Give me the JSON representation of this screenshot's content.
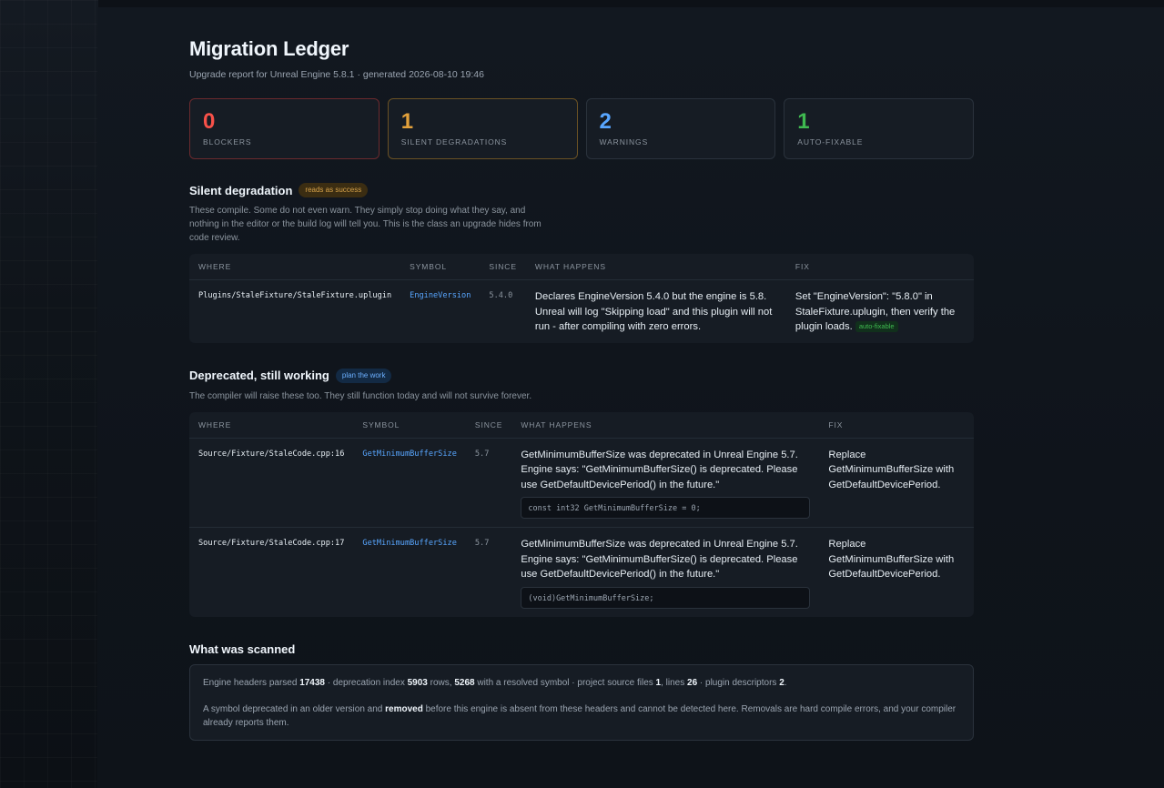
{
  "header": {
    "title": "Migration Ledger",
    "subtitle": "Upgrade report for Unreal Engine 5.8.1 · generated 2026-08-10 19:46"
  },
  "summary": [
    {
      "value": "0",
      "label": "BLOCKERS",
      "color": "#f85149"
    },
    {
      "value": "1",
      "label": "SILENT DEGRADATIONS",
      "color": "#e3a13b"
    },
    {
      "value": "2",
      "label": "WARNINGS",
      "color": "#58a6ff"
    },
    {
      "value": "1",
      "label": "AUTO-FIXABLE",
      "color": "#3fb950"
    }
  ],
  "silent": {
    "title": "Silent degradation",
    "badge": "reads as success",
    "description": "These compile. Some do not even warn. They simply stop doing what they say, and nothing in the editor or the build log will tell you. This is the class an upgrade hides from code review.",
    "columns": [
      "WHERE",
      "SYMBOL",
      "SINCE",
      "WHAT HAPPENS",
      "FIX"
    ],
    "rows": [
      {
        "where": "Plugins/StaleFixture/StaleFixture.uplugin",
        "symbol": "EngineVersion",
        "since": "5.4.0",
        "what": "Declares EngineVersion 5.4.0 but the engine is 5.8. Unreal will log \"Skipping load\" and this plugin will not run - after compiling with zero errors.",
        "fix": "Set \"EngineVersion\": \"5.8.0\" in StaleFixture.uplugin, then verify the plugin loads.",
        "tag": "auto-fixable"
      }
    ]
  },
  "deprecated": {
    "title": "Deprecated, still working",
    "badge": "plan the work",
    "description": "The compiler will raise these too. They still function today and will not survive forever.",
    "columns": [
      "WHERE",
      "SYMBOL",
      "SINCE",
      "WHAT HAPPENS",
      "FIX"
    ],
    "rows": [
      {
        "where": "Source/Fixture/StaleCode.cpp:16",
        "symbol": "GetMinimumBufferSize",
        "since": "5.7",
        "what": "GetMinimumBufferSize was deprecated in Unreal Engine 5.7. Engine says: \"GetMinimumBufferSize() is deprecated. Please use GetDefaultDevicePeriod() in the future.\"",
        "code": "const int32 GetMinimumBufferSize = 0;",
        "fix": "Replace GetMinimumBufferSize with GetDefaultDevicePeriod."
      },
      {
        "where": "Source/Fixture/StaleCode.cpp:17",
        "symbol": "GetMinimumBufferSize",
        "since": "5.7",
        "what": "GetMinimumBufferSize was deprecated in Unreal Engine 5.7. Engine says: \"GetMinimumBufferSize() is deprecated. Please use GetDefaultDevicePeriod() in the future.\"",
        "code": "(void)GetMinimumBufferSize;",
        "fix": "Replace GetMinimumBufferSize with GetDefaultDevicePeriod."
      }
    ]
  },
  "scanned": {
    "title": "What was scanned",
    "line1": {
      "p1": "Engine headers parsed ",
      "headers": "17438",
      "p2": " · deprecation index ",
      "index_rows": "5903",
      "p3": " rows, ",
      "resolved": "5268",
      "p4": " with a resolved symbol · project source files ",
      "files": "1",
      "p5": ", lines ",
      "lines": "26",
      "p6": " · plugin descriptors ",
      "descriptors": "2",
      "p7": "."
    },
    "line2": {
      "p1": "A symbol deprecated in an older version and ",
      "removed": "removed",
      "p2": " before this engine is absent from these headers and cannot be detected here. Removals are hard compile errors, and your compiler already reports them."
    }
  }
}
